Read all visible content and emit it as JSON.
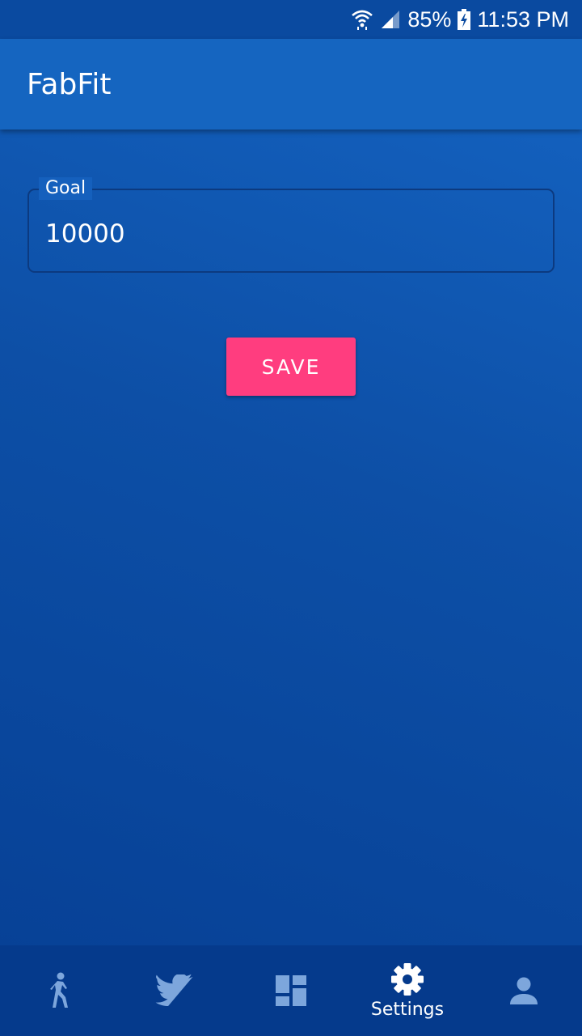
{
  "status_bar": {
    "battery": "85%",
    "time": "11:53 PM",
    "icons": [
      "wifi-icon",
      "signal-icon",
      "battery-charging-icon"
    ]
  },
  "app_bar": {
    "title": "FabFit"
  },
  "goal": {
    "label": "Goal",
    "value": "10000"
  },
  "save_button": {
    "label": "SAVE"
  },
  "bottom_nav": {
    "items": [
      {
        "icon": "walk-icon",
        "label": ""
      },
      {
        "icon": "twitter-icon",
        "label": ""
      },
      {
        "icon": "dashboard-icon",
        "label": ""
      },
      {
        "icon": "settings-icon",
        "label": "Settings",
        "active": true
      },
      {
        "icon": "person-icon",
        "label": ""
      }
    ]
  },
  "colors": {
    "app_bar": "#1565c0",
    "background": "#0d4fa6",
    "accent": "#ff3d7f",
    "nav_bar": "#053a8c",
    "inactive_icon": "#7da6dc"
  }
}
